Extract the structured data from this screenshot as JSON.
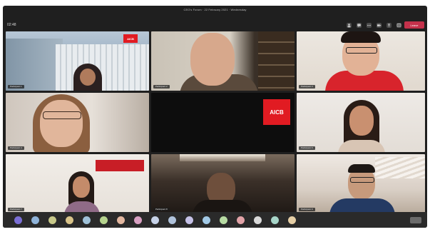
{
  "window": {
    "title": "CEO's Forum · 22 February 2021 · Wednesday"
  },
  "toolbar": {
    "timer": "02:48",
    "leave_label": "Leave",
    "icons": [
      "people-icon",
      "chat-icon",
      "more-icon",
      "camera-icon",
      "mic-icon",
      "share-icon"
    ]
  },
  "brand": {
    "logo_text": "AICB"
  },
  "tiles": [
    {
      "name": "Participant 1"
    },
    {
      "name": "Participant 2"
    },
    {
      "name": "Participant 3"
    },
    {
      "name": "Participant 4"
    },
    {
      "name": ""
    },
    {
      "name": "Participant 6"
    },
    {
      "name": "Participant 7"
    },
    {
      "name": "Participant 8"
    },
    {
      "name": "Participant 9"
    }
  ],
  "dock": {
    "avatars": [
      {
        "initials": "",
        "color": "#7b6fd6"
      },
      {
        "initials": "",
        "color": "#8fb3d9"
      },
      {
        "initials": "",
        "color": "#c8c98a"
      },
      {
        "initials": "",
        "color": "#d9c48a"
      },
      {
        "initials": "",
        "color": "#9fc1d8"
      },
      {
        "initials": "",
        "color": "#b6d48e"
      },
      {
        "initials": "",
        "color": "#e3b7a0"
      },
      {
        "initials": "",
        "color": "#d8a0c2"
      },
      {
        "initials": "",
        "color": "#c6d2e8"
      },
      {
        "initials": "",
        "color": "#b0c3dc"
      },
      {
        "initials": "",
        "color": "#c6c2e8"
      },
      {
        "initials": "",
        "color": "#a2c9e6"
      },
      {
        "initials": "",
        "color": "#b7dba3"
      },
      {
        "initials": "",
        "color": "#e2a3a8"
      },
      {
        "initials": "",
        "color": "#d9d9d9"
      },
      {
        "initials": "",
        "color": "#a7d5c9"
      },
      {
        "initials": "",
        "color": "#e6cfa6"
      }
    ]
  }
}
